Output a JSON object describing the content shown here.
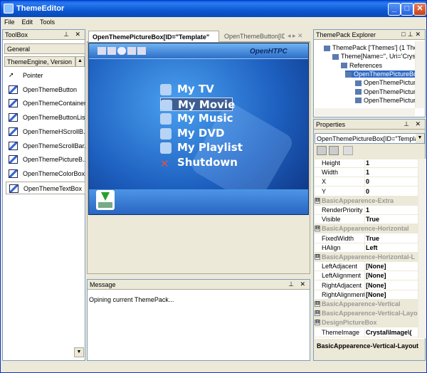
{
  "window": {
    "title": "ThemeEditor"
  },
  "menu": [
    "File",
    "Edit",
    "Tools"
  ],
  "toolbox": {
    "title": "ToolBox",
    "groups": [
      "General",
      "ThemeEngine, Version"
    ],
    "items": [
      "Pointer",
      "OpenThemeButton",
      "OpenThemeContainer",
      "OpenThemeButtonList",
      "OpenThemeHScrollB...",
      "OpenThemeScrollBar...",
      "OpenThemePictureB...",
      "OpenThemeColorBox",
      "OpenThemeTextBox"
    ]
  },
  "tabs": {
    "active": "OpenThemePictureBox[ID=\"Template\"",
    "other": "OpenThemeButton[ID="
  },
  "canvas": {
    "brand": "OpenHTPC",
    "menu": [
      "My TV",
      "My Movie",
      "My Music",
      "My DVD",
      "My Playlist",
      "Shutdown"
    ],
    "selected": "My Movie"
  },
  "message": {
    "title": "Message",
    "text": "Opining current ThemePack..."
  },
  "explorer": {
    "title": "ThemePack Explorer",
    "nodes": [
      "ThemePack ['Themes'] (1 Them",
      "Theme[Name=\", Uri='Crys",
      "References",
      "OpenThemePictureBox",
      "OpenThemePicture",
      "OpenThemePicture",
      "OpenThemePicture"
    ]
  },
  "properties": {
    "title": "Properties",
    "selector": "OpenThemePictureBox[ID=\"Template\"",
    "rows": [
      {
        "k": "Height",
        "v": "1"
      },
      {
        "k": "Width",
        "v": "1"
      },
      {
        "k": "X",
        "v": "0"
      },
      {
        "k": "Y",
        "v": "0"
      },
      {
        "k": "BasicAppearence-Extra",
        "cat": true
      },
      {
        "k": "RenderPriority",
        "v": "1"
      },
      {
        "k": "Visible",
        "v": "True"
      },
      {
        "k": "BasicAppearence-Horizontal",
        "cat": true
      },
      {
        "k": "FixedWidth",
        "v": "True"
      },
      {
        "k": "HAlign",
        "v": "Left"
      },
      {
        "k": "BasicAppearence-Horizontal-L",
        "cat": true
      },
      {
        "k": "LeftAdjacent",
        "v": "[None]"
      },
      {
        "k": "LeftAlignment",
        "v": "[None]"
      },
      {
        "k": "RightAdjacent",
        "v": "[None]"
      },
      {
        "k": "RightAlignment",
        "v": "[None]"
      },
      {
        "k": "BasicAppearence-Vertical",
        "cat": true
      },
      {
        "k": "BasicAppearence-Vertical-Layo",
        "cat": true
      },
      {
        "k": "DesignPictureBox",
        "cat": true
      },
      {
        "k": "ThemeImage",
        "v": "Crystal\\Image\\("
      }
    ],
    "description": "BasicAppearence-Vertical-Layout"
  }
}
